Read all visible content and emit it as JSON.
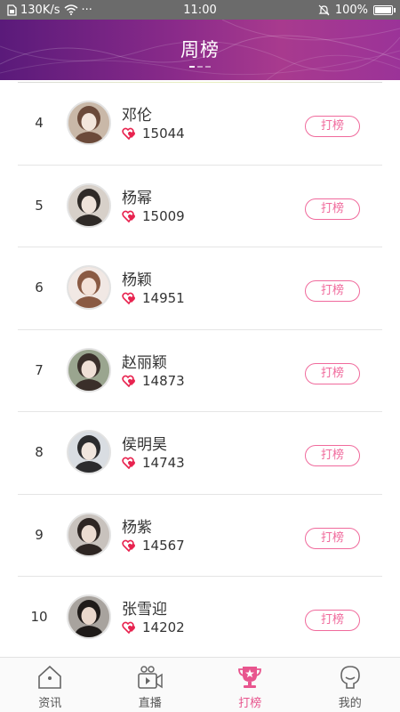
{
  "status_bar": {
    "network_speed": "130K/s",
    "more": "···",
    "time": "11:00",
    "battery": "100%"
  },
  "header": {
    "title": "周榜",
    "page_dots": 3,
    "active_dot": 0
  },
  "colors": {
    "accent_pink": "#f06a9c",
    "header_gradient": [
      "#5a1a7a",
      "#a83a8e"
    ],
    "heart": "#e8234f"
  },
  "ranking": [
    {
      "rank": "4",
      "name": "邓伦",
      "score": "15044",
      "vote_label": "打榜"
    },
    {
      "rank": "5",
      "name": "杨幂",
      "score": "15009",
      "vote_label": "打榜"
    },
    {
      "rank": "6",
      "name": "杨颖",
      "score": "14951",
      "vote_label": "打榜"
    },
    {
      "rank": "7",
      "name": "赵丽颖",
      "score": "14873",
      "vote_label": "打榜"
    },
    {
      "rank": "8",
      "name": "侯明昊",
      "score": "14743",
      "vote_label": "打榜"
    },
    {
      "rank": "9",
      "name": "杨紫",
      "score": "14567",
      "vote_label": "打榜"
    },
    {
      "rank": "10",
      "name": "张雪迎",
      "score": "14202",
      "vote_label": "打榜"
    }
  ],
  "tabbar": {
    "tabs": [
      {
        "label": "资讯",
        "icon": "house-icon",
        "active": false
      },
      {
        "label": "直播",
        "icon": "video-camera-icon",
        "active": false
      },
      {
        "label": "打榜",
        "icon": "trophy-icon",
        "active": true
      },
      {
        "label": "我的",
        "icon": "profile-icon",
        "active": false
      }
    ]
  }
}
